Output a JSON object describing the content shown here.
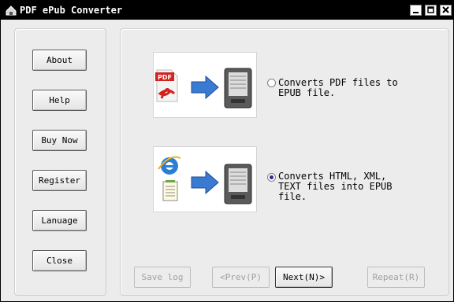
{
  "window": {
    "title": "PDF ePub Converter"
  },
  "sidebar": {
    "buttons": [
      {
        "label": "About"
      },
      {
        "label": "Help"
      },
      {
        "label": "Buy Now"
      },
      {
        "label": "Register"
      },
      {
        "label": "Lanuage"
      },
      {
        "label": "Close"
      }
    ]
  },
  "options": [
    {
      "line1": "Converts PDF files to",
      "line2": "EPUB file.",
      "line3": "",
      "selected": false
    },
    {
      "line1": "Converts HTML, XML,",
      "line2": "TEXT files into EPUB",
      "line3": "file.",
      "selected": true
    }
  ],
  "footer": {
    "save_log": "Save log",
    "prev": "<Prev(P)",
    "next": "Next(N)>",
    "repeat": "Repeat(R)"
  }
}
